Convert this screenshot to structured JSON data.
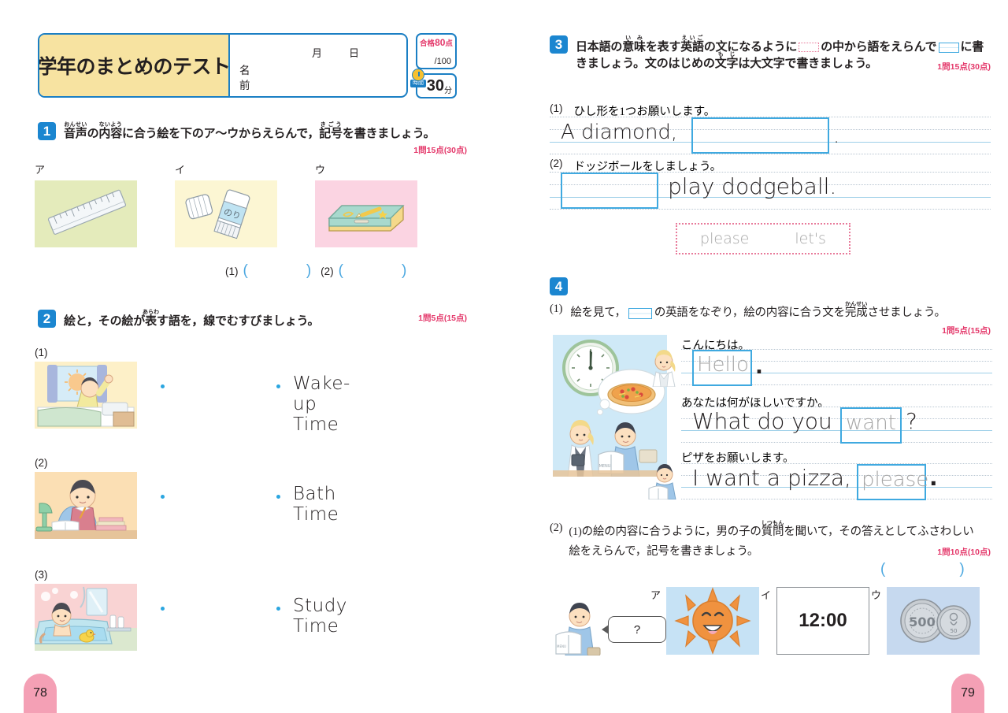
{
  "header": {
    "title": "学年のまとめのテスト",
    "month_label": "月",
    "day_label": "日",
    "name_line1": "名",
    "name_line2": "前",
    "pass_prefix": "合格",
    "pass_score": "80",
    "pass_suffix": "点",
    "out_of": "/100",
    "time_icon_label": "時間",
    "time_value": "30",
    "time_unit": "分"
  },
  "q1": {
    "number": "1",
    "text_1": "音声",
    "ruby_1": "おんせい",
    "text_2": "の",
    "text_3": "内容",
    "ruby_3": "ないよう",
    "text_4": "に合う絵を下のア〜ウからえらんで，",
    "text_5": "記号",
    "ruby_5": "きごう",
    "text_6": "を書きましょう。",
    "points": "1問15点(30点)",
    "options": [
      {
        "letter": "ア",
        "caption": "ruler-illustration",
        "bg": "#e4ebbb"
      },
      {
        "letter": "イ",
        "caption": "glue-stick-illustration",
        "bg": "#fcf6d3",
        "glue_label": "のり"
      },
      {
        "letter": "ウ",
        "caption": "pencil-case-illustration",
        "bg": "#fbd4e2"
      }
    ],
    "answers": [
      {
        "num": "(1)"
      },
      {
        "num": "(2)"
      }
    ]
  },
  "q2": {
    "number": "2",
    "text_1": "絵と，その絵が",
    "text_2": "表",
    "ruby_2": "あらわ",
    "text_3": "す語を，線でむすびましょう。",
    "points": "1問5点(15点)",
    "rows": [
      {
        "num": "(1)",
        "picture": "boy-waking-up-illustration",
        "word": "Wake-up Time"
      },
      {
        "num": "(2)",
        "picture": "boy-studying-illustration",
        "word": "Bath Time"
      },
      {
        "num": "(3)",
        "picture": "boy-in-bath-illustration",
        "word": "Study Time"
      }
    ]
  },
  "q3": {
    "number": "3",
    "line1_a": "日本語の",
    "line1_b": "意味",
    "ruby_1b": "いみ",
    "line1_c": "を表す",
    "line1_d": "英語",
    "ruby_1d": "えいご",
    "line1_e": "の文になるように",
    "line1_f": "の中から語をえらんで",
    "line1_g": "に書",
    "line2_a": "きましょう。文のはじめの",
    "line2_b": "文字",
    "ruby_2b": "もじ",
    "line2_c": "は大文字で書きましょう。",
    "points": "1問15点(30点)",
    "items": [
      {
        "num": "(1)",
        "jp": "ひし形を1つお願いします。",
        "before": "A diamond,",
        "after": "."
      },
      {
        "num": "(2)",
        "jp": "ドッジボールをしましょう。",
        "before": "",
        "after": "play dodgeball."
      }
    ],
    "bank": [
      "please",
      "let's"
    ]
  },
  "q4": {
    "number": "4",
    "sub1": {
      "num": "(1)",
      "text_a": "絵を見て，",
      "text_b": "の英語をなぞり，絵の内容に合う文を",
      "text_c": "完成",
      "ruby_c": "かんせい",
      "text_d": "させましょう。",
      "points": "1問5点(15点)",
      "picture": "restaurant-scene-illustration",
      "dialogue": [
        {
          "speaker": "waitress-avatar",
          "jp": "こんにちは。",
          "trace": "Hello",
          "trace_pos": "start",
          "before": "",
          "after": "."
        },
        {
          "speaker": "",
          "jp": "あなたは何がほしいですか。",
          "before": "What do you",
          "trace": "want",
          "after": "?"
        },
        {
          "speaker": "boy-avatar",
          "jp": "ピザをお願いします。",
          "before": "I want a pizza,",
          "trace": "please",
          "after": "."
        }
      ]
    },
    "sub2": {
      "num": "(2)",
      "line1_a": "(1)の絵の内容に合うように，男の子の",
      "line1_b": "質問",
      "ruby_1b": "しつもん",
      "line1_c": "を聞いて，その答えとしてふさわしい",
      "line2": "絵をえらんで，記号を書きましょう。",
      "points": "1問10点(10点)",
      "speech_bubble": "?",
      "speaker_picture": "boy-reading-menu-illustration",
      "options": [
        {
          "letter": "ア",
          "caption": "sun-illustration",
          "bg": "#c6e2f5"
        },
        {
          "letter": "イ",
          "caption": "clock-time",
          "value": "12:00",
          "bg": "#ffffff"
        },
        {
          "letter": "ウ",
          "caption": "coins-illustration",
          "bg": "#c6d9ef"
        }
      ]
    }
  },
  "pages": {
    "left": "78",
    "right": "79"
  },
  "colors": {
    "accent_blue": "#1b86d0",
    "line_blue": "#3fa9e0",
    "points_red": "#e4396b",
    "tab_pink": "#f4a0b5",
    "header_yellow": "#f7e3a1"
  }
}
